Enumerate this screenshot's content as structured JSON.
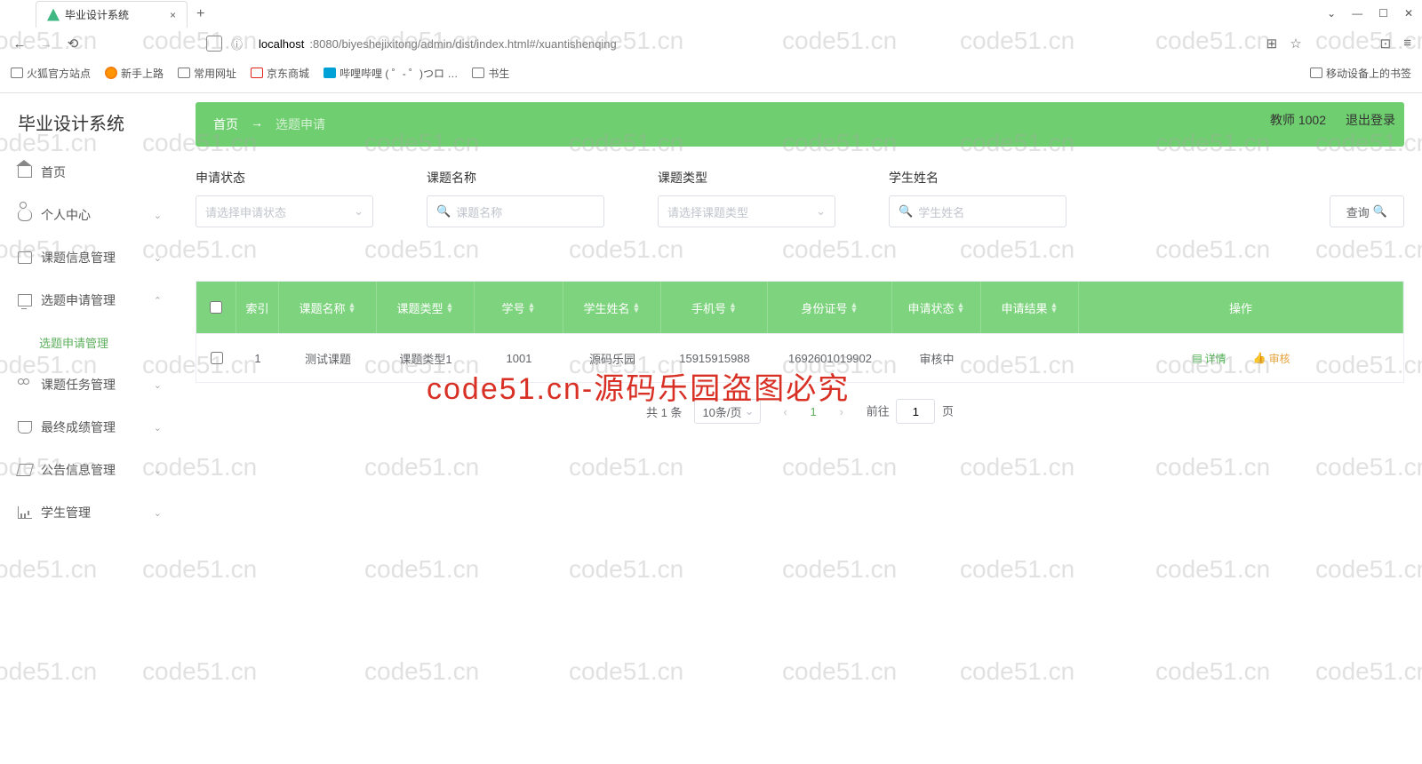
{
  "browser": {
    "tab_title": "毕业设计系统",
    "url_host": "localhost",
    "url_path": ":8080/biyeshejixitong/admin/dist/index.html#/xuantishenqing",
    "bookmarks": [
      "火狐官方站点",
      "新手上路",
      "常用网址",
      "京东商城",
      "哔哩哔哩 ( ゜- ゜)つロ …",
      "书生"
    ],
    "mobile_bookmarks": "移动设备上的书签"
  },
  "app": {
    "brand": "毕业设计系统",
    "user_label": "教师 1002",
    "logout": "退出登录",
    "breadcrumb_home": "首页",
    "breadcrumb_sep": "→",
    "breadcrumb_current": "选题申请"
  },
  "sidebar": {
    "home": "首页",
    "personal": "个人中心",
    "topic_info": "课题信息管理",
    "topic_apply": "选题申请管理",
    "topic_apply_sub": "选题申请管理",
    "task": "课题任务管理",
    "score": "最终成绩管理",
    "notice": "公告信息管理",
    "student": "学生管理"
  },
  "filters": {
    "status_label": "申请状态",
    "status_placeholder": "请选择申请状态",
    "name_label": "课题名称",
    "name_placeholder": "课题名称",
    "type_label": "课题类型",
    "type_placeholder": "请选择课题类型",
    "student_label": "学生姓名",
    "student_placeholder": "学生姓名",
    "query": "查询"
  },
  "table": {
    "headers": {
      "idx": "索引",
      "name": "课题名称",
      "type": "课题类型",
      "sno": "学号",
      "sname": "学生姓名",
      "phone": "手机号",
      "id": "身份证号",
      "status": "申请状态",
      "result": "申请结果",
      "ops": "操作"
    },
    "rows": [
      {
        "idx": "1",
        "name": "测试课题",
        "type": "课题类型1",
        "sno": "1001",
        "sname": "源码乐园",
        "phone": "15915915988",
        "id": "1692601019902",
        "status": "审核中",
        "result": ""
      }
    ],
    "ops_detail": "详情",
    "ops_audit": "审核"
  },
  "pagination": {
    "total": "共 1 条",
    "page_size": "10条/页",
    "current": "1",
    "goto_prefix": "前往",
    "goto_val": "1",
    "goto_suffix": "页"
  },
  "watermark": {
    "text": "code51.cn",
    "big_red": "code51.cn-源码乐园盗图必究"
  }
}
